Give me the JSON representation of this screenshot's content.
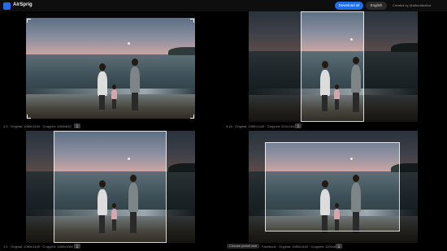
{
  "app": {
    "title": "AirSprig",
    "download_all": "Download all",
    "language": "English",
    "credit": "Created by @alfreddesilva"
  },
  "panels": [
    {
      "label": "4:3",
      "original": "Original: 1080x1440",
      "cropped": "Cropped: 1080x810",
      "download_icon": "download-icon"
    },
    {
      "label": "9:16",
      "original": "Original: 1080x1440",
      "cropped": "Cropped: 810x1440",
      "download_icon": "download-icon"
    },
    {
      "label": "1:1",
      "original": "Original: 1080x1440",
      "cropped": "Cropped: 1080x1080",
      "download_icon": "download-icon"
    },
    {
      "label": "Facebook",
      "original": "Original: 1080x1440",
      "cropped": "Cropped: 1200x628",
      "chip": "Choose preset size",
      "download_icon": "download-icon"
    }
  ],
  "colors": {
    "accent": "#1f6feb",
    "background": "#000000"
  }
}
